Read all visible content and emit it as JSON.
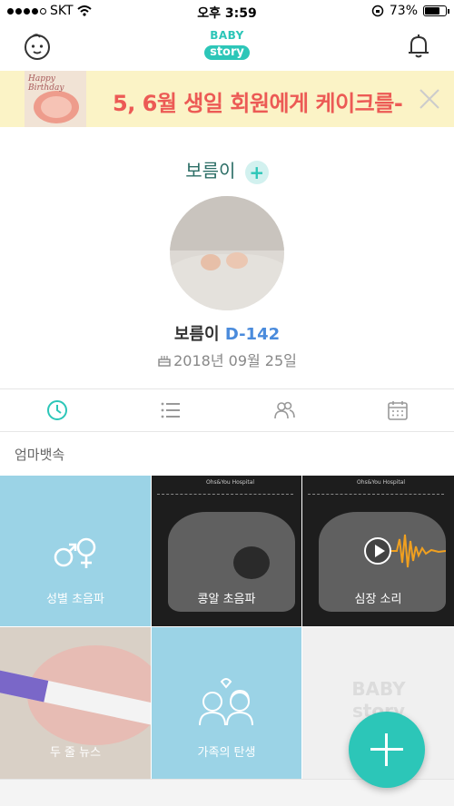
{
  "status_bar": {
    "carrier": "SKT",
    "time": "오후 3:59",
    "battery": "73%",
    "battery_level": 0.73
  },
  "nav": {
    "logo_line1": "BABY",
    "logo_line2": "story"
  },
  "banner": {
    "text": "5, 6월 생일 회원에게 케이크를-",
    "cake_text": "Happy Birthday"
  },
  "profile": {
    "name": "보름이",
    "add_symbol": "+",
    "child_name": "보름이",
    "dday": "D-142",
    "due_date": "2018년 09월 25일"
  },
  "section_label": "엄마뱃속",
  "tiles": [
    {
      "label": "성별 초음파"
    },
    {
      "label": "콩알 초음파"
    },
    {
      "label": "심장 소리"
    },
    {
      "label": "두 줄 뉴스"
    },
    {
      "label": "가족의 탄생"
    },
    {
      "label": ""
    }
  ],
  "watermark": {
    "line1": "BABY",
    "line2": "story"
  },
  "colors": {
    "accent": "#2cc6b8",
    "tile_blue": "#9bd3e6",
    "dday": "#4a8bdc",
    "banner_text": "#ec5a55"
  },
  "icons": [
    "baby-face-icon",
    "bell-icon",
    "close-icon",
    "clock-icon",
    "list-icon",
    "family-icon",
    "calendar-icon",
    "cake-icon",
    "gender-icon",
    "couple-icon",
    "play-icon",
    "plus-icon"
  ]
}
